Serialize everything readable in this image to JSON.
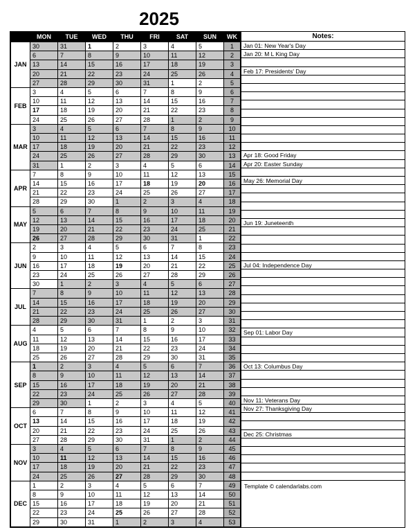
{
  "year": "2025",
  "day_headers": [
    "MON",
    "TUE",
    "WED",
    "THU",
    "FRI",
    "SAT",
    "SUN",
    "WK"
  ],
  "notes_header": "Notes:",
  "footer_text": "Template © calendarlabs.com",
  "holidays": {
    "JAN": {
      "1": true
    },
    "FEB": {
      "17": true
    },
    "APR": {
      "18": true,
      "20": true
    },
    "MAY": {
      "26": true
    },
    "JUN": {
      "19": true
    },
    "JUL": {
      "4": true
    },
    "SEP": {
      "1": true
    },
    "OCT": {
      "13": true
    },
    "NOV": {
      "11": true,
      "27": true
    },
    "DEC": {
      "25": true
    }
  },
  "months": [
    {
      "label": "JAN",
      "rows": [
        {
          "days": [
            30,
            31,
            1,
            2,
            3,
            4,
            5
          ],
          "wk": 1,
          "shaded_from": 2
        },
        {
          "days": [
            6,
            7,
            8,
            9,
            10,
            11,
            12
          ],
          "wk": 2
        },
        {
          "days": [
            13,
            14,
            15,
            16,
            17,
            18,
            19
          ],
          "wk": 3
        },
        {
          "days": [
            20,
            21,
            22,
            23,
            24,
            25,
            26
          ],
          "wk": 4
        },
        {
          "days": [
            27,
            28,
            29,
            30,
            31,
            1,
            2
          ],
          "wk": 5,
          "shaded_to": 4
        }
      ]
    },
    {
      "label": "FEB",
      "rows": [
        {
          "days": [
            3,
            4,
            5,
            6,
            7,
            8,
            9
          ],
          "wk": 6
        },
        {
          "days": [
            10,
            11,
            12,
            13,
            14,
            15,
            16
          ],
          "wk": 7
        },
        {
          "days": [
            17,
            18,
            19,
            20,
            21,
            22,
            23
          ],
          "wk": 8
        },
        {
          "days": [
            24,
            25,
            26,
            27,
            28,
            1,
            2
          ],
          "wk": 9,
          "shaded_from": 5
        }
      ]
    },
    {
      "label": "MAR",
      "rows": [
        {
          "days": [
            3,
            4,
            5,
            6,
            7,
            8,
            9
          ],
          "wk": 10
        },
        {
          "days": [
            10,
            11,
            12,
            13,
            14,
            15,
            16
          ],
          "wk": 11
        },
        {
          "days": [
            17,
            18,
            19,
            20,
            21,
            22,
            23
          ],
          "wk": 12
        },
        {
          "days": [
            24,
            25,
            26,
            27,
            28,
            29,
            30
          ],
          "wk": 13
        },
        {
          "days": [
            31,
            1,
            2,
            3,
            4,
            5,
            6
          ],
          "wk": 14,
          "shaded_to": 0
        }
      ]
    },
    {
      "label": "APR",
      "rows": [
        {
          "days": [
            7,
            8,
            9,
            10,
            11,
            12,
            13
          ],
          "wk": 15
        },
        {
          "days": [
            14,
            15,
            16,
            17,
            18,
            19,
            20
          ],
          "wk": 16
        },
        {
          "days": [
            21,
            22,
            23,
            24,
            25,
            26,
            27
          ],
          "wk": 17
        },
        {
          "days": [
            28,
            29,
            30,
            1,
            2,
            3,
            4
          ],
          "wk": 18,
          "shaded_from": 3
        }
      ]
    },
    {
      "label": "MAY",
      "rows": [
        {
          "days": [
            5,
            6,
            7,
            8,
            9,
            10,
            11
          ],
          "wk": 19
        },
        {
          "days": [
            12,
            13,
            14,
            15,
            16,
            17,
            18
          ],
          "wk": 20
        },
        {
          "days": [
            19,
            20,
            21,
            22,
            23,
            24,
            25
          ],
          "wk": 21
        },
        {
          "days": [
            26,
            27,
            28,
            29,
            30,
            31,
            1
          ],
          "wk": 22,
          "shaded_to": 5
        }
      ]
    },
    {
      "label": "JUN",
      "rows": [
        {
          "days": [
            2,
            3,
            4,
            5,
            6,
            7,
            8
          ],
          "wk": 23
        },
        {
          "days": [
            9,
            10,
            11,
            12,
            13,
            14,
            15
          ],
          "wk": 24
        },
        {
          "days": [
            16,
            17,
            18,
            19,
            20,
            21,
            22
          ],
          "wk": 25
        },
        {
          "days": [
            23,
            24,
            25,
            26,
            27,
            28,
            29
          ],
          "wk": 26
        },
        {
          "days": [
            30,
            1,
            2,
            3,
            4,
            5,
            6
          ],
          "wk": 27,
          "shaded_from": 1
        }
      ]
    },
    {
      "label": "JUL",
      "rows": [
        {
          "days": [
            7,
            8,
            9,
            10,
            11,
            12,
            13
          ],
          "wk": 28
        },
        {
          "days": [
            14,
            15,
            16,
            17,
            18,
            19,
            20
          ],
          "wk": 29
        },
        {
          "days": [
            21,
            22,
            23,
            24,
            25,
            26,
            27
          ],
          "wk": 30
        },
        {
          "days": [
            28,
            29,
            30,
            31,
            1,
            2,
            3
          ],
          "wk": 31,
          "shaded_to": 3
        }
      ]
    },
    {
      "label": "AUG",
      "rows": [
        {
          "days": [
            4,
            5,
            6,
            7,
            8,
            9,
            10
          ],
          "wk": 32
        },
        {
          "days": [
            11,
            12,
            13,
            14,
            15,
            16,
            17
          ],
          "wk": 33
        },
        {
          "days": [
            18,
            19,
            20,
            21,
            22,
            23,
            24
          ],
          "wk": 34
        },
        {
          "days": [
            25,
            26,
            27,
            28,
            29,
            30,
            31
          ],
          "wk": 35
        }
      ]
    },
    {
      "label": "SEP",
      "rows": [
        {
          "days": [
            1,
            2,
            3,
            4,
            5,
            6,
            7
          ],
          "wk": 36
        },
        {
          "days": [
            8,
            9,
            10,
            11,
            12,
            13,
            14
          ],
          "wk": 37
        },
        {
          "days": [
            15,
            16,
            17,
            18,
            19,
            20,
            21
          ],
          "wk": 38
        },
        {
          "days": [
            22,
            23,
            24,
            25,
            26,
            27,
            28
          ],
          "wk": 39
        },
        {
          "days": [
            29,
            30,
            1,
            2,
            3,
            4,
            5
          ],
          "wk": 40,
          "shaded_to": 1
        }
      ]
    },
    {
      "label": "OCT",
      "rows": [
        {
          "days": [
            6,
            7,
            8,
            9,
            10,
            11,
            12
          ],
          "wk": 41
        },
        {
          "days": [
            13,
            14,
            15,
            16,
            17,
            18,
            19
          ],
          "wk": 42
        },
        {
          "days": [
            20,
            21,
            22,
            23,
            24,
            25,
            26
          ],
          "wk": 43
        },
        {
          "days": [
            27,
            28,
            29,
            30,
            31,
            1,
            2
          ],
          "wk": 44,
          "shaded_from": 5
        }
      ]
    },
    {
      "label": "NOV",
      "rows": [
        {
          "days": [
            3,
            4,
            5,
            6,
            7,
            8,
            9
          ],
          "wk": 45
        },
        {
          "days": [
            10,
            11,
            12,
            13,
            14,
            15,
            16
          ],
          "wk": 46
        },
        {
          "days": [
            17,
            18,
            19,
            20,
            21,
            22,
            23
          ],
          "wk": 47
        },
        {
          "days": [
            24,
            25,
            26,
            27,
            28,
            29,
            30
          ],
          "wk": 48
        }
      ]
    },
    {
      "label": "DEC",
      "rows": [
        {
          "days": [
            1,
            2,
            3,
            4,
            5,
            6,
            7
          ],
          "wk": 49
        },
        {
          "days": [
            8,
            9,
            10,
            11,
            12,
            13,
            14
          ],
          "wk": 50
        },
        {
          "days": [
            15,
            16,
            17,
            18,
            19,
            20,
            21
          ],
          "wk": 51
        },
        {
          "days": [
            22,
            23,
            24,
            25,
            26,
            27,
            28
          ],
          "wk": 52
        },
        {
          "days": [
            29,
            30,
            31,
            1,
            2,
            3,
            4
          ],
          "wk": 53,
          "shaded_to": 2
        }
      ]
    }
  ],
  "notes": [
    "Jan 01: New Year's Day",
    "Jan 20: M L King Day",
    "",
    "Feb 17: Presidents' Day",
    "",
    "",
    "",
    "",
    "",
    "",
    "",
    "",
    "",
    "Apr 18: Good Friday",
    "Apr 20: Easter Sunday",
    "",
    "May 26: Memorial Day",
    "",
    "",
    "",
    "",
    "Jun 19: Juneteenth",
    "",
    "",
    "",
    "",
    "Jul 04: Independence Day",
    "",
    "",
    "",
    "",
    "",
    "",
    "",
    "Sep 01: Labor Day",
    "",
    "",
    "",
    "Oct 13: Columbus Day",
    "",
    "",
    "",
    "Nov 11: Veterans Day",
    "Nov 27: Thanksgiving Day",
    "",
    "",
    "Dec 25: Christmas",
    "",
    "",
    "",
    "",
    ""
  ]
}
